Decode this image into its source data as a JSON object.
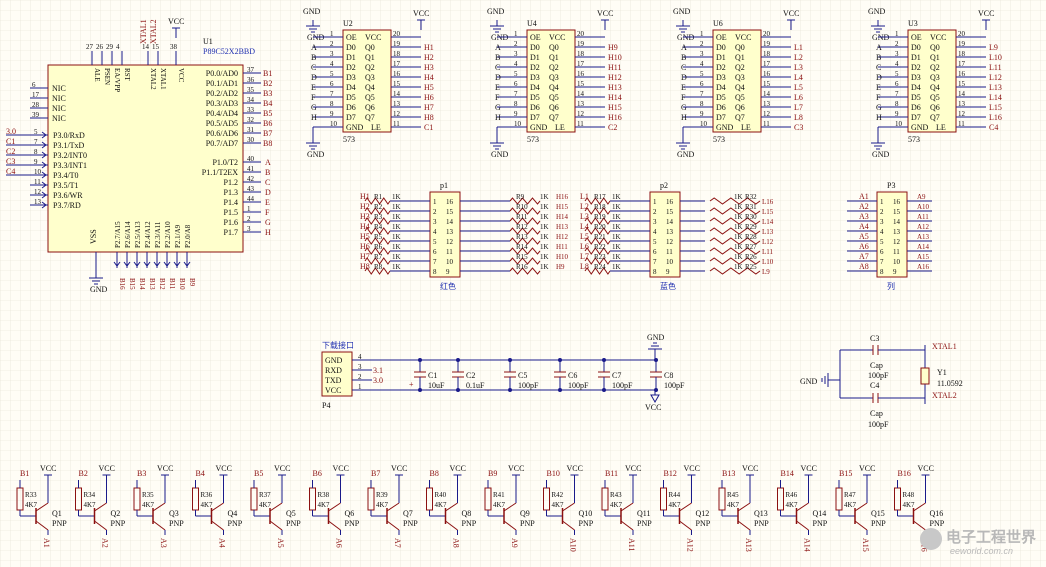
{
  "colors": {
    "wire": "#1a1a8a",
    "part": "#8b1010",
    "text": "#101010",
    "label": "#2030b0",
    "body_fill": "#ffffcc"
  },
  "latches": [
    {
      "ref": "U2",
      "part": "573",
      "in": [
        "A",
        "B",
        "C",
        "D",
        "E",
        "F",
        "G",
        "H"
      ],
      "out": [
        "H1",
        "H2",
        "H3",
        "H4",
        "H5",
        "H6",
        "H7",
        "H8"
      ],
      "le": "C1"
    },
    {
      "ref": "U4",
      "part": "573",
      "in": [
        "A",
        "B",
        "C",
        "D",
        "E",
        "F",
        "G",
        "H"
      ],
      "out": [
        "H9",
        "H10",
        "H11",
        "H12",
        "H13",
        "H14",
        "H15",
        "H16"
      ],
      "le": "C2"
    },
    {
      "ref": "U6",
      "part": "573",
      "in": [
        "A",
        "B",
        "C",
        "D",
        "E",
        "F",
        "G",
        "H"
      ],
      "out": [
        "L1",
        "L2",
        "L3",
        "L4",
        "L5",
        "L6",
        "L7",
        "L8"
      ],
      "le": "C3"
    },
    {
      "ref": "U3",
      "part": "573",
      "in": [
        "A",
        "B",
        "C",
        "D",
        "E",
        "F",
        "G",
        "H"
      ],
      "out": [
        "L9",
        "L10",
        "L11",
        "L12",
        "L13",
        "L14",
        "L15",
        "L16"
      ],
      "le": "C4"
    }
  ],
  "latch_pins": {
    "left_names": [
      "OE",
      "D0",
      "D1",
      "D2",
      "D3",
      "D4",
      "D5",
      "D6",
      "D7"
    ],
    "right_names": [
      "VCC",
      "Q0",
      "Q1",
      "Q2",
      "Q3",
      "Q4",
      "Q5",
      "Q6",
      "Q7"
    ],
    "left_nums": [
      "1",
      "2",
      "3",
      "4",
      "5",
      "6",
      "7",
      "8",
      "9"
    ],
    "right_nums": [
      "20",
      "19",
      "18",
      "17",
      "16",
      "15",
      "14",
      "13",
      "12"
    ],
    "gnd": "GND",
    "le": "LE",
    "gnd_num": "10",
    "le_num": "11"
  },
  "mcu": {
    "ref": "U1",
    "part": "P89C52X2BBD",
    "top_pins": [
      {
        "name": "ALE",
        "num": "27"
      },
      {
        "name": "PSEN",
        "num": "26"
      },
      {
        "name": "EA/VPP",
        "num": "29"
      },
      {
        "name": "RST",
        "num": "4"
      },
      {
        "name": "XTAL2",
        "num": "14"
      },
      {
        "name": "XTAL1",
        "num": "15"
      },
      {
        "name": "VCC",
        "num": "38"
      }
    ],
    "top_nets": [
      "XTAL1",
      "XTAL2",
      "VCC"
    ],
    "nc": [
      {
        "name": "NIC",
        "num": "6"
      },
      {
        "name": "NIC",
        "num": "17"
      },
      {
        "name": "NIC",
        "num": "28"
      },
      {
        "name": "NIC",
        "num": "39"
      }
    ],
    "p3": [
      {
        "name": "P3.0/RxD",
        "num": "5",
        "net": "3.0"
      },
      {
        "name": "P3.1/TxD",
        "num": "7",
        "net": "C1"
      },
      {
        "name": "P3.2/INT0",
        "num": "8",
        "net": "C2"
      },
      {
        "name": "P3.3/INT1",
        "num": "9",
        "net": "C3"
      },
      {
        "name": "P3.4/T0",
        "num": "10",
        "net": "C4"
      },
      {
        "name": "P3.5/T1",
        "num": "11",
        "net": ""
      },
      {
        "name": "P3.6/WR",
        "num": "12",
        "net": ""
      },
      {
        "name": "P3.7/RD",
        "num": "13",
        "net": ""
      }
    ],
    "p0": [
      {
        "name": "P0.0/AD0",
        "num": "37",
        "net": "B1"
      },
      {
        "name": "P0.1/AD1",
        "num": "36",
        "net": "B2"
      },
      {
        "name": "P0.2/AD2",
        "num": "35",
        "net": "B3"
      },
      {
        "name": "P0.3/AD3",
        "num": "34",
        "net": "B4"
      },
      {
        "name": "P0.4/AD4",
        "num": "33",
        "net": "B5"
      },
      {
        "name": "P0.5/AD5",
        "num": "32",
        "net": "B6"
      },
      {
        "name": "P0.6/AD6",
        "num": "31",
        "net": "B7"
      },
      {
        "name": "P0.7/AD7",
        "num": "30",
        "net": "B8"
      }
    ],
    "p1": [
      {
        "name": "P1.0/T2",
        "num": "40",
        "net": "A"
      },
      {
        "name": "P1.1/T2EX",
        "num": "41",
        "net": "B"
      },
      {
        "name": "P1.2",
        "num": "42",
        "net": "C"
      },
      {
        "name": "P1.3",
        "num": "43",
        "net": "D"
      },
      {
        "name": "P1.4",
        "num": "44",
        "net": "E"
      },
      {
        "name": "P1.5",
        "num": "1",
        "net": "F"
      },
      {
        "name": "P1.6",
        "num": "2",
        "net": "G"
      },
      {
        "name": "P1.7",
        "num": "3",
        "net": "H"
      }
    ],
    "p2": [
      {
        "name": "P2.7/A15",
        "num": "25",
        "net": "B16"
      },
      {
        "name": "P2.6/A14",
        "num": "24",
        "net": "B15"
      },
      {
        "name": "P2.5/A13",
        "num": "23",
        "net": "B14"
      },
      {
        "name": "P2.4/A12",
        "num": "22",
        "net": "B13"
      },
      {
        "name": "P2.3/A11",
        "num": "21",
        "net": "B12"
      },
      {
        "name": "P2.2/A10",
        "num": "20",
        "net": "B11"
      },
      {
        "name": "P2.1/A9",
        "num": "19",
        "net": "B10"
      },
      {
        "name": "P2.0/A8",
        "num": "18",
        "net": "B9"
      }
    ],
    "vss": "VSS",
    "gnd": "GND"
  },
  "headers": [
    {
      "ref": "p1",
      "caption": "红色",
      "nets": [
        "H1",
        "H2",
        "H3",
        "H4",
        "H5",
        "H6",
        "H7",
        "H8"
      ],
      "res": [
        "R1",
        "R2",
        "R3",
        "R4",
        "R5",
        "R6",
        "R7",
        "R8"
      ],
      "right_nets": [
        "H16",
        "H15",
        "H14",
        "H13",
        "H12",
        "H11",
        "H10",
        "H9"
      ]
    },
    {
      "ref": "p2",
      "caption": "蓝色",
      "nets": [
        "L1",
        "L2",
        "L3",
        "L4",
        "L5",
        "L6",
        "L7",
        "L8"
      ],
      "res": [
        "R17",
        "R18",
        "R19",
        "R20",
        "R21",
        "R22",
        "R23",
        "R24"
      ],
      "right_nets": [
        "L16",
        "L15",
        "L14",
        "L13",
        "L12",
        "L11",
        "L10",
        "L9"
      ]
    },
    {
      "ref": "P3",
      "caption": "列",
      "nets": [
        "A1",
        "A2",
        "A3",
        "A4",
        "A5",
        "A6",
        "A7",
        "A8"
      ],
      "res": [],
      "right_nets": [
        "A9",
        "A10",
        "A11",
        "A12",
        "A13",
        "A14",
        "A15",
        "A16"
      ]
    }
  ],
  "header_pins": {
    "left": [
      "1",
      "2",
      "3",
      "4",
      "5",
      "6",
      "7",
      "8"
    ],
    "right": [
      "16",
      "15",
      "14",
      "13",
      "12",
      "11",
      "10",
      "9"
    ]
  },
  "res_value": "1K",
  "mid_res": [
    {
      "ref": "R9",
      "net": "H16"
    },
    {
      "ref": "R10",
      "net": "H15"
    },
    {
      "ref": "R11",
      "net": "H14"
    },
    {
      "ref": "R12",
      "net": "H13"
    },
    {
      "ref": "R13",
      "net": "H12"
    },
    {
      "ref": "R14",
      "net": "H11"
    },
    {
      "ref": "R15",
      "net": "H10"
    },
    {
      "ref": "R16",
      "net": "H9"
    }
  ],
  "right_res": [
    {
      "ref": "R32",
      "net": "L16"
    },
    {
      "ref": "R31",
      "net": "L15"
    },
    {
      "ref": "R30",
      "net": "L14"
    },
    {
      "ref": "R29",
      "net": "L13"
    },
    {
      "ref": "R28",
      "net": "L12"
    },
    {
      "ref": "R27",
      "net": "L11"
    },
    {
      "ref": "R26",
      "net": "L10"
    },
    {
      "ref": "R25",
      "net": "L9"
    }
  ],
  "download": {
    "title": "下载接口",
    "ref": "P4",
    "pins": [
      {
        "name": "GND",
        "num": "4"
      },
      {
        "name": "RXD",
        "num": "3",
        "net": "3.1"
      },
      {
        "name": "TXD",
        "num": "2",
        "net": "3.0"
      },
      {
        "name": "VCC",
        "num": "1"
      }
    ]
  },
  "caps": [
    {
      "ref": "C1",
      "value": "10uF",
      "polar": true
    },
    {
      "ref": "C2",
      "value": "0.1uF",
      "polar": false
    },
    {
      "ref": "C5",
      "value": "100pF",
      "polar": false
    },
    {
      "ref": "C6",
      "value": "100pF",
      "polar": false
    },
    {
      "ref": "C7",
      "value": "100pF",
      "polar": false
    },
    {
      "ref": "C8",
      "value": "100pF",
      "polar": false
    }
  ],
  "crystal": {
    "ref": "Y1",
    "value": "11.0592",
    "c3": "C3",
    "c4": "C4",
    "cap_type": "Cap",
    "cap_value": "100pF",
    "xtal1": "XTAL1",
    "xtal2": "XTAL2",
    "gnd": "GND"
  },
  "drivers": {
    "bases": [
      "B1",
      "B2",
      "B3",
      "B4",
      "B5",
      "B6",
      "B7",
      "B8",
      "B9",
      "B10",
      "B11",
      "B12",
      "B13",
      "B14",
      "B15",
      "B16"
    ],
    "res": [
      "R33",
      "R34",
      "R35",
      "R36",
      "R37",
      "R38",
      "R39",
      "R40",
      "R41",
      "R42",
      "R43",
      "R44",
      "R45",
      "R46",
      "R47",
      "R48"
    ],
    "res_value": "4K7",
    "trans": [
      "Q1",
      "Q2",
      "Q3",
      "Q4",
      "Q5",
      "Q6",
      "Q7",
      "Q8",
      "Q9",
      "Q10",
      "Q11",
      "Q12",
      "Q13",
      "Q14",
      "Q15",
      "Q16"
    ],
    "type": "PNP",
    "collectors": [
      "A1",
      "A2",
      "A3",
      "A4",
      "A5",
      "A6",
      "A7",
      "A8",
      "A9",
      "A10",
      "A11",
      "A12",
      "A13",
      "A14",
      "A15",
      "A16"
    ]
  },
  "power": {
    "vcc": "VCC",
    "gnd": "GND"
  },
  "watermark": {
    "main": "电子工程世界",
    "sub": "eeworld.com.cn"
  }
}
